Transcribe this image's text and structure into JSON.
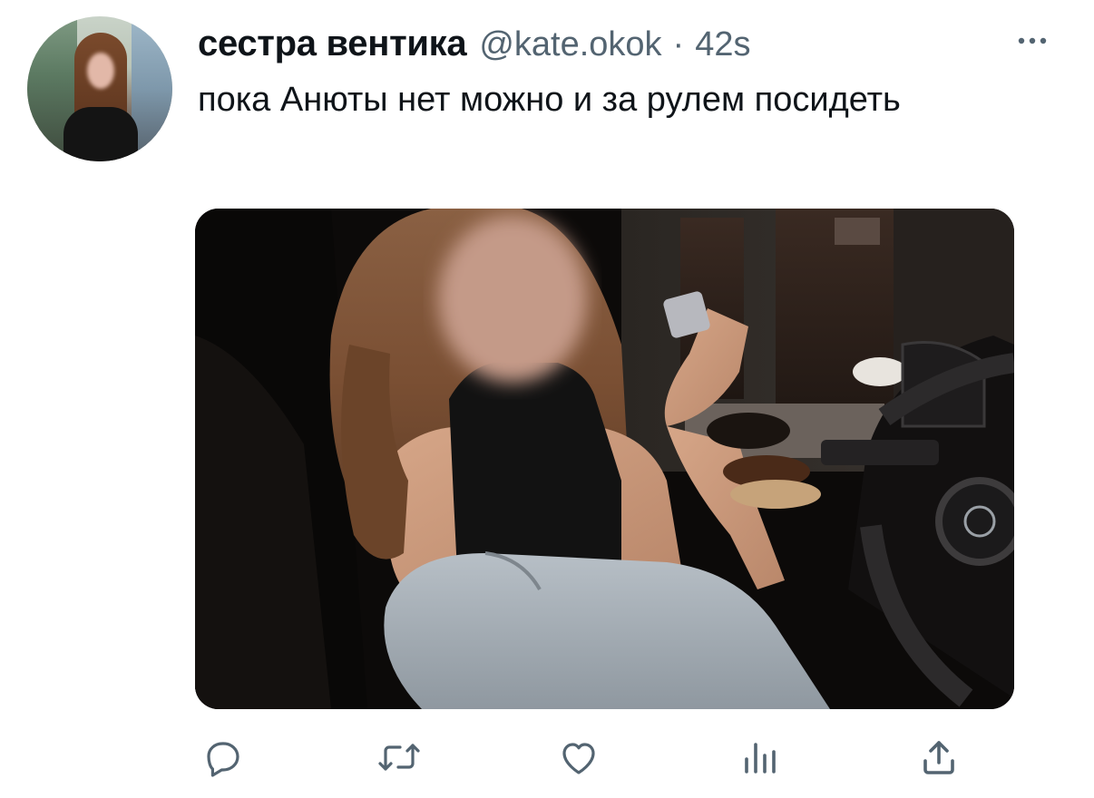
{
  "tweet": {
    "display_name": "сестра вентика",
    "handle": "@kate.okok",
    "separator": "·",
    "timestamp": "42s",
    "text": "пока Анюты нет можно и за рулем посидеть"
  },
  "icons": {
    "more": "more-horizontal-icon",
    "reply": "reply-icon",
    "retweet": "retweet-icon",
    "like": "heart-icon",
    "views": "analytics-icon",
    "share": "share-icon"
  },
  "colors": {
    "text_primary": "#0f1419",
    "text_secondary": "#536471",
    "icon": "#536471"
  }
}
